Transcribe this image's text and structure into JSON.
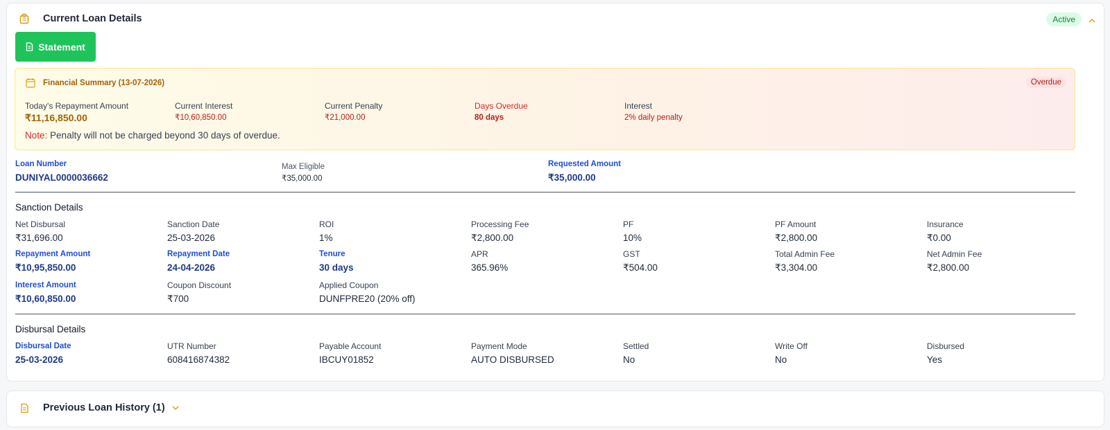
{
  "current_loan": {
    "title": "Current Loan Details",
    "status": "Active",
    "statement_button": "Statement",
    "financial_summary": {
      "title": "Financial Summary (13-07-2026)",
      "badge": "Overdue",
      "items": [
        {
          "label": "Today's Repayment Amount",
          "value": "₹11,16,850.00"
        },
        {
          "label": "Current Interest",
          "value": "₹10,60,850.00"
        },
        {
          "label": "Current Penalty",
          "value": "₹21,000.00"
        },
        {
          "label": "Days Overdue",
          "value": "80 days"
        },
        {
          "label": "Interest",
          "value": "2% daily penalty"
        }
      ],
      "note_label": "Note:",
      "note_text": "Penalty will not be charged beyond 30 days of overdue."
    },
    "loan_info": [
      {
        "label": "Loan Number",
        "value": "DUNIYAL0000036662"
      },
      {
        "label": "Max Eligible",
        "value": "₹35,000.00"
      },
      {
        "label": "Requested Amount",
        "value": "₹35,000.00"
      }
    ],
    "sanction": {
      "title": "Sanction Details",
      "fields": [
        {
          "label": "Net Disbursal",
          "value": "₹31,696.00"
        },
        {
          "label": "Sanction Date",
          "value": "25-03-2026"
        },
        {
          "label": "ROI",
          "value": "1%"
        },
        {
          "label": "Processing Fee",
          "value": "₹2,800.00"
        },
        {
          "label": "PF",
          "value": "10%"
        },
        {
          "label": "PF Amount",
          "value": "₹2,800.00"
        },
        {
          "label": "Insurance",
          "value": "₹0.00"
        },
        {
          "label": "Repayment Amount",
          "value": "₹10,95,850.00"
        },
        {
          "label": "Repayment Date",
          "value": "24-04-2026"
        },
        {
          "label": "Tenure",
          "value": "30 days"
        },
        {
          "label": "APR",
          "value": "365.96%"
        },
        {
          "label": "GST",
          "value": "₹504.00"
        },
        {
          "label": "Total Admin Fee",
          "value": "₹3,304.00"
        },
        {
          "label": "Net Admin Fee",
          "value": "₹2,800.00"
        },
        {
          "label": "Interest Amount",
          "value": "₹10,60,850.00"
        },
        {
          "label": "Coupon Discount",
          "value": "₹700"
        },
        {
          "label": "Applied Coupon",
          "value": "DUNFPRE20 (20% off)"
        }
      ]
    },
    "disbursal": {
      "title": "Disbursal Details",
      "fields": [
        {
          "label": "Disbursal Date",
          "value": "25-03-2026"
        },
        {
          "label": "UTR Number",
          "value": "608416874382"
        },
        {
          "label": "Payable Account",
          "value": "IBCUY01852"
        },
        {
          "label": "Payment Mode",
          "value": "AUTO DISBURSED"
        },
        {
          "label": "Settled",
          "value": "No"
        },
        {
          "label": "Write Off",
          "value": "No"
        },
        {
          "label": "Disbursed",
          "value": "Yes"
        }
      ]
    }
  },
  "previous_loans": {
    "title": "Previous Loan History (1)"
  },
  "colors": {
    "accent_green": "#1ec45a",
    "highlight_blue": "#1d4ed8",
    "overdue_red": "#dc2626",
    "amber": "#a16207"
  },
  "icons": {
    "header": "briefcase-icon",
    "statement": "document-icon",
    "summary": "calendar-icon",
    "collapse": "chevron-up-icon",
    "expand": "chevron-down-icon"
  }
}
